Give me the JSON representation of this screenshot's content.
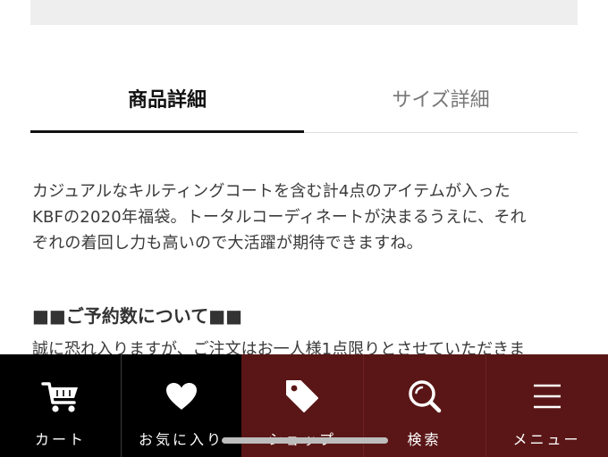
{
  "tabs": [
    {
      "label": "商品詳細",
      "active": true
    },
    {
      "label": "サイズ詳細",
      "active": false
    }
  ],
  "description": [
    "カジュアルなキルティングコートを含む計4点のアイテムが入った",
    "KBFの2020年福袋。トータルコーディネートが決まるうえに、それ",
    "ぞれの着回し力も高いので大活躍が期待できますね。"
  ],
  "section_heading": "■■ご予約数について■■",
  "cut_text": "誠に恐れ入りますが、ご注文はお一人様1点限りとさせていただきま",
  "bottom_nav": [
    {
      "label": "カート",
      "icon": "cart-icon"
    },
    {
      "label": "お気に入り",
      "icon": "heart-icon"
    },
    {
      "label": "ショップ",
      "icon": "tag-icon"
    },
    {
      "label": "検索",
      "icon": "search-icon"
    },
    {
      "label": "メニュー",
      "icon": "menu-icon"
    }
  ],
  "colors": {
    "nav_black": "#000000",
    "nav_red": "#5a1616",
    "tab_active": "#111111",
    "tab_inactive": "#777777"
  }
}
